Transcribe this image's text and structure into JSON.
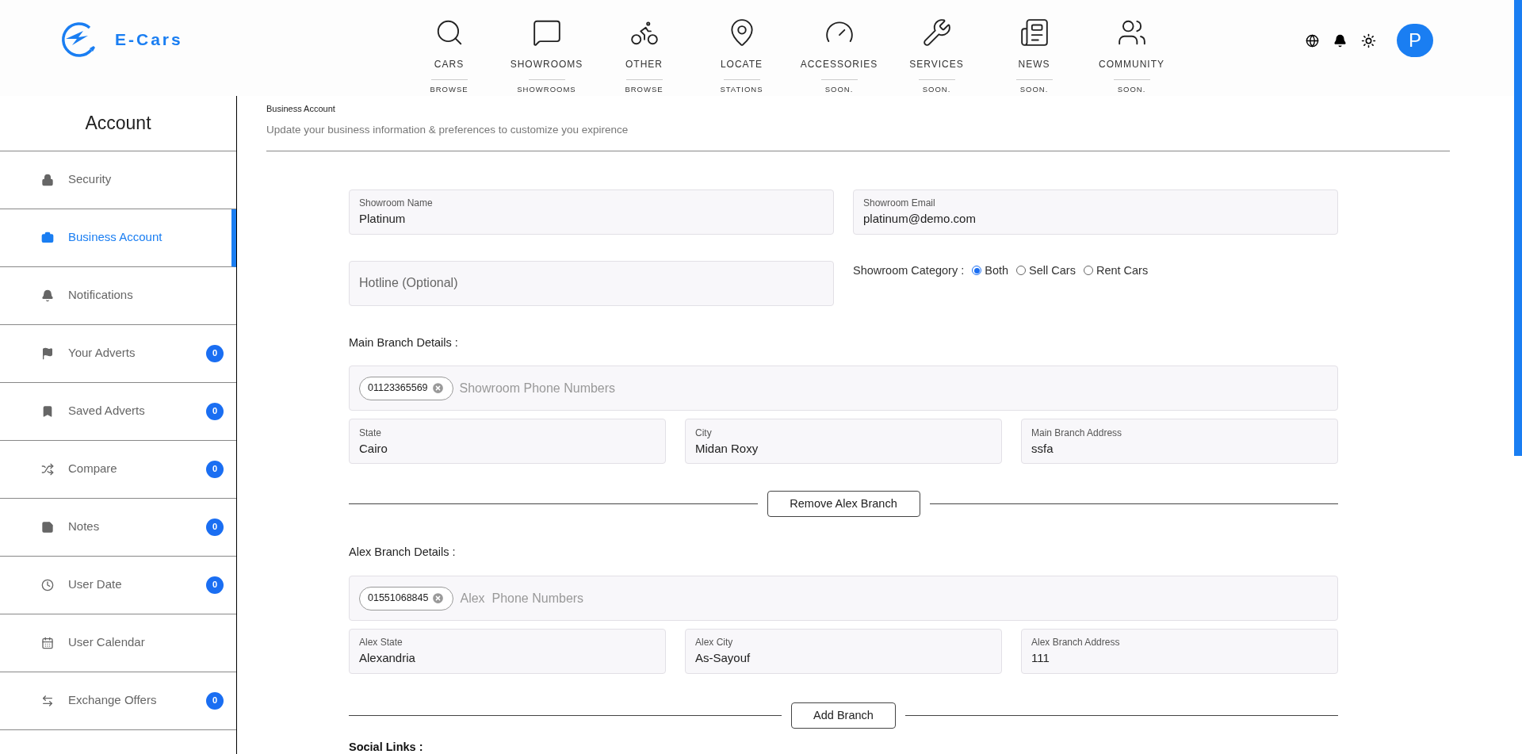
{
  "logo": {
    "text": "E-Cars"
  },
  "nav": [
    {
      "label": "CARS",
      "sub": "BROWSE"
    },
    {
      "label": "SHOWROOMS",
      "sub": "SHOWROOMS"
    },
    {
      "label": "OTHER",
      "sub": "BROWSE"
    },
    {
      "label": "LOCATE",
      "sub": "STATIONS"
    },
    {
      "label": "ACCESSORIES",
      "sub": "SOON."
    },
    {
      "label": "SERVICES",
      "sub": "SOON."
    },
    {
      "label": "NEWS",
      "sub": "SOON."
    },
    {
      "label": "COMMUNITY",
      "sub": "SOON."
    }
  ],
  "user": {
    "avatar": "P"
  },
  "sidebar": {
    "title": "Account",
    "items": [
      {
        "label": "Security",
        "selected": false
      },
      {
        "label": "Business Account",
        "selected": true
      },
      {
        "label": "Notifications",
        "selected": false
      },
      {
        "label": "Your Adverts",
        "selected": false,
        "badge": "0"
      },
      {
        "label": "Saved Adverts",
        "selected": false,
        "badge": "0"
      },
      {
        "label": "Compare",
        "selected": false,
        "badge": "0"
      },
      {
        "label": "Notes",
        "selected": false,
        "badge": "0"
      },
      {
        "label": "User Date",
        "selected": false,
        "badge": "0"
      },
      {
        "label": "User Calendar",
        "selected": false
      },
      {
        "label": "Exchange Offers",
        "selected": false,
        "badge": "0"
      }
    ]
  },
  "page": {
    "breadcrumb": "Business Account",
    "subtitle": "Update your business information & preferences to customize you expirence"
  },
  "form": {
    "showroom_name": {
      "label": "Showroom Name",
      "value": "Platinum"
    },
    "showroom_email": {
      "label": "Showroom Email",
      "value": "platinum@demo.com"
    },
    "hotline": {
      "placeholder": "Hotline (Optional)"
    },
    "category": {
      "label": "Showroom Category :",
      "options": [
        {
          "label": "Both",
          "selected": true
        },
        {
          "label": "Sell Cars",
          "selected": false
        },
        {
          "label": "Rent Cars",
          "selected": false
        }
      ]
    },
    "branches": [
      {
        "heading": "Main Branch Details :",
        "phones": [
          "01123365569"
        ],
        "phone_placeholder": "Showroom Phone Numbers",
        "fields": [
          {
            "label": "State",
            "value": "Cairo"
          },
          {
            "label": "City",
            "value": "Midan Roxy"
          },
          {
            "label": "Main Branch Address",
            "value": "ssfa"
          }
        ],
        "button": "Remove Alex Branch"
      },
      {
        "heading": "Alex Branch Details :",
        "phones": [
          "01551068845"
        ],
        "phone_placeholder": "Alex  Phone Numbers",
        "fields": [
          {
            "label": "Alex State",
            "value": "Alexandria"
          },
          {
            "label": "Alex City",
            "value": "As-Sayouf"
          },
          {
            "label": "Alex Branch Address",
            "value": "111"
          }
        ],
        "button": "Add Branch"
      }
    ],
    "social_heading": "Social Links :"
  }
}
